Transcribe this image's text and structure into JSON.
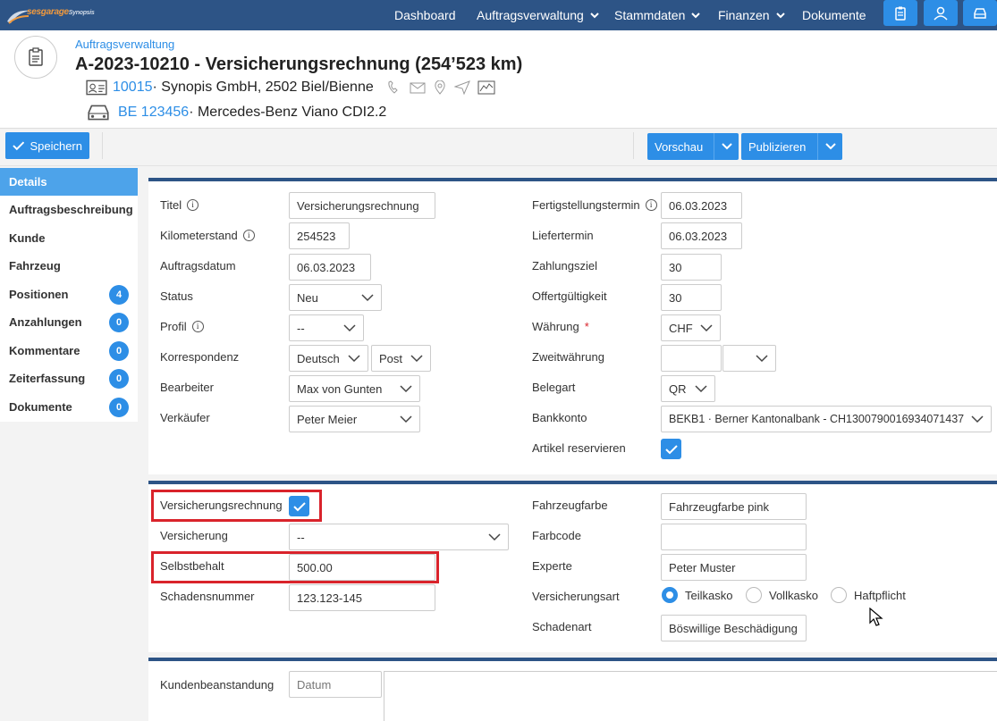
{
  "brand": {
    "logo_main": "sesgarage",
    "logo_sub": "Synopsis"
  },
  "nav": {
    "items": [
      {
        "label": "Dashboard"
      },
      {
        "label": "Auftragsverwaltung"
      },
      {
        "label": "Stammdaten"
      },
      {
        "label": "Finanzen"
      },
      {
        "label": "Dokumente"
      }
    ]
  },
  "header": {
    "breadcrumb": "Auftragsverwaltung",
    "title": "A-2023-10210 - Versicherungsrechnung (254’523 km)",
    "customer_id": "10015",
    "customer_name": " · Synopis GmbH, 2502 Biel/Bienne",
    "plate": "BE 123456",
    "vehicle": " · Mercedes-Benz Viano CDI2.2"
  },
  "toolbar": {
    "save": "Speichern",
    "preview": "Vorschau",
    "publish": "Publizieren"
  },
  "sidebar": {
    "items": [
      {
        "label": "Details"
      },
      {
        "label": "Auftragsbeschreibung"
      },
      {
        "label": "Kunde"
      },
      {
        "label": "Fahrzeug"
      },
      {
        "label": "Positionen",
        "badge": "4"
      },
      {
        "label": "Anzahlungen",
        "badge": "0"
      },
      {
        "label": "Kommentare",
        "badge": "0"
      },
      {
        "label": "Zeiterfassung",
        "badge": "0"
      },
      {
        "label": "Dokumente",
        "badge": "0"
      }
    ]
  },
  "details": {
    "titel": {
      "label": "Titel",
      "value": "Versicherungsrechnung"
    },
    "km": {
      "label": "Kilometerstand",
      "value": "254523"
    },
    "auftragsdatum": {
      "label": "Auftragsdatum",
      "value": "06.03.2023"
    },
    "status": {
      "label": "Status",
      "value": "Neu"
    },
    "profil": {
      "label": "Profil",
      "value": "--"
    },
    "korrespondenz": {
      "label": "Korrespondenz",
      "lang": "Deutsch",
      "channel": "Post"
    },
    "bearbeiter": {
      "label": "Bearbeiter",
      "value": "Max von Gunten"
    },
    "verkaeufer": {
      "label": "Verkäufer",
      "value": "Peter Meier"
    },
    "fertig": {
      "label": "Fertigstellungstermin",
      "value": "06.03.2023"
    },
    "liefer": {
      "label": "Liefertermin",
      "value": "06.03.2023"
    },
    "zahlungsziel": {
      "label": "Zahlungsziel",
      "value": "30"
    },
    "offert": {
      "label": "Offertgültigkeit",
      "value": "30"
    },
    "waehrung": {
      "label": "Währung",
      "required": "*",
      "value": "CHF"
    },
    "zweit": {
      "label": "Zweitwährung",
      "value": ""
    },
    "belegart": {
      "label": "Belegart",
      "value": "QR"
    },
    "bank": {
      "label": "Bankkonto",
      "value": "BEKB1 · Berner Kantonalbank - CH1300790016934071437"
    },
    "artikel": {
      "label": "Artikel reservieren",
      "checked": true
    }
  },
  "insurance": {
    "vr": {
      "label": "Versicherungsrechnung",
      "checked": true
    },
    "versicherung": {
      "label": "Versicherung",
      "value": "--"
    },
    "selbstbehalt": {
      "label": "Selbstbehalt",
      "value": "500.00"
    },
    "schaden": {
      "label": "Schadensnummer",
      "value": "123.123-145"
    },
    "farbe": {
      "label": "Fahrzeugfarbe",
      "value": "Fahrzeugfarbe pink"
    },
    "farbcode": {
      "label": "Farbcode",
      "value": ""
    },
    "experte": {
      "label": "Experte",
      "value": "Peter Muster"
    },
    "art": {
      "label": "Versicherungsart",
      "options": [
        "Teilkasko",
        "Vollkasko",
        "Haftpflicht"
      ],
      "selected": "Teilkasko"
    },
    "schadenart": {
      "label": "Schadenart",
      "value": "Böswillige Beschädigung"
    }
  },
  "complaint": {
    "label": "Kundenbeanstandung",
    "date_placeholder": "Datum"
  },
  "colors": {
    "nav": "#2d5486",
    "accent": "#2d8ee6",
    "highlight": "#d9232b"
  }
}
